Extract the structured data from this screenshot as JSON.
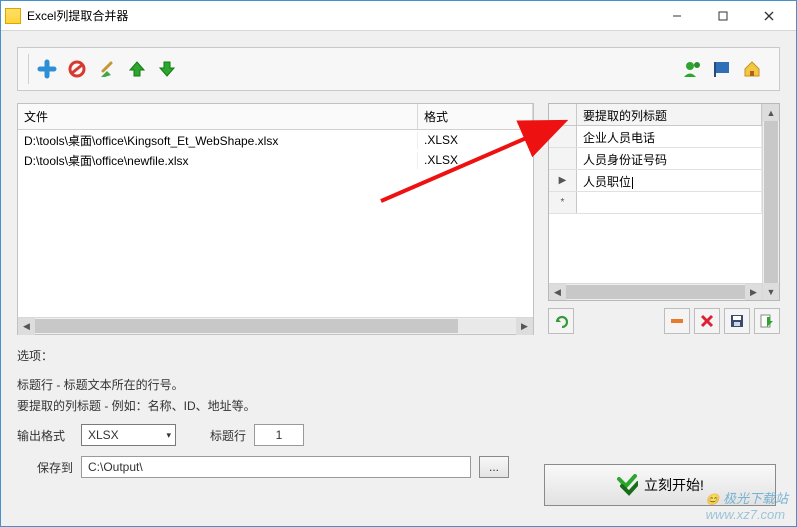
{
  "window": {
    "title": "Excel列提取合并器"
  },
  "toolbar": {
    "left_icons": [
      "plus-icon",
      "forbid-icon",
      "broom-icon",
      "arrow-up-icon",
      "arrow-down-icon"
    ],
    "right_icons": [
      "user-icon",
      "flag-icon",
      "home-icon"
    ]
  },
  "file_table": {
    "columns": {
      "file": "文件",
      "format": "格式"
    },
    "rows": [
      {
        "file": "D:\\tools\\桌面\\office\\Kingsoft_Et_WebShape.xlsx",
        "format": ".XLSX"
      },
      {
        "file": "D:\\tools\\桌面\\office\\newfile.xlsx",
        "format": ".XLSX"
      }
    ]
  },
  "column_grid": {
    "header": "要提取的列标题",
    "rows": [
      "企业人员电话",
      "人员身份证号码",
      "人员职位"
    ],
    "editing_row_index": 2,
    "new_row_marker": "*",
    "current_marker": "▶"
  },
  "right_buttons": [
    "redo-icon",
    "remove-row-icon",
    "delete-icon",
    "save-icon",
    "export-icon"
  ],
  "options": {
    "label": "选项：",
    "desc1": "标题行 - 标题文本所在的行号。",
    "desc2": "要提取的列标题 - 例如：名称、ID、地址等。",
    "output_format_label": "输出格式",
    "output_format_value": "XLSX",
    "header_row_label": "标题行",
    "header_row_value": "1",
    "save_to_label": "保存到",
    "save_to_path": "C:\\Output\\",
    "browse_label": "..."
  },
  "start_button": {
    "label": "立刻开始!"
  },
  "watermark": {
    "brand": "极光下载站",
    "url": "www.xz7.com"
  }
}
